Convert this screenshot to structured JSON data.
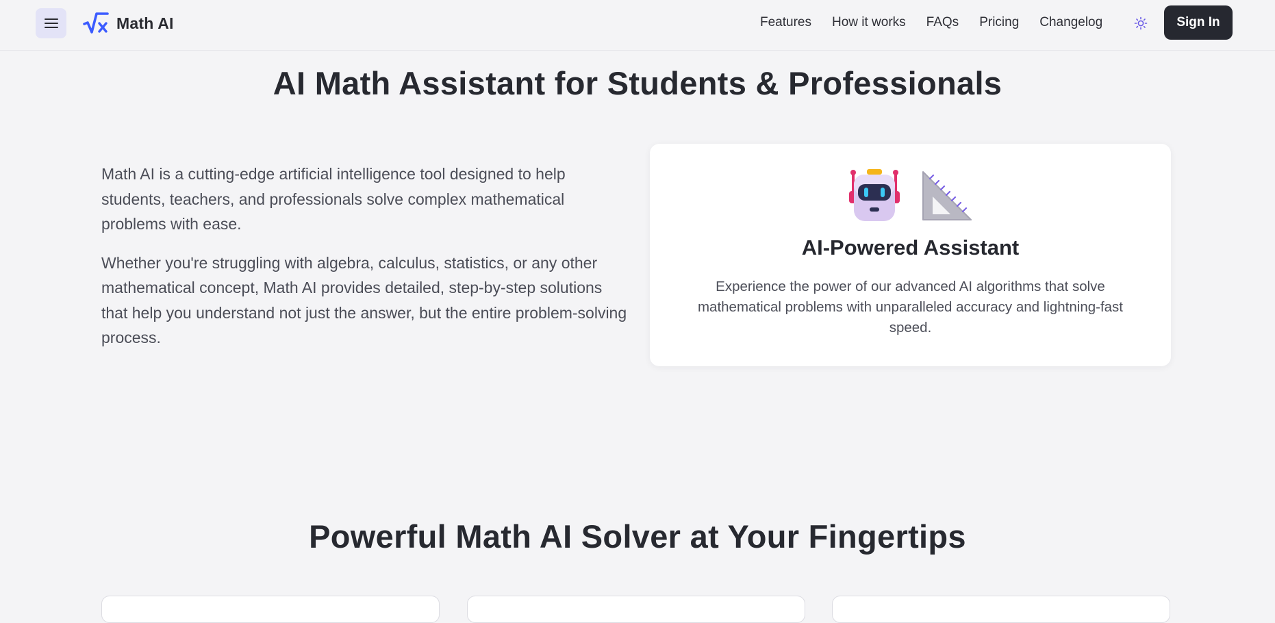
{
  "header": {
    "menu_icon": "hamburger-menu-icon",
    "logo_icon": "sqrt-x-logo-icon",
    "logo_text": "Math AI",
    "nav": [
      {
        "label": "Features"
      },
      {
        "label": "How it works"
      },
      {
        "label": "FAQs"
      },
      {
        "label": "Pricing"
      },
      {
        "label": "Changelog"
      }
    ],
    "theme_icon": "sun-icon",
    "signin_label": "Sign In"
  },
  "hero": {
    "title": "AI Math Assistant for Students & Professionals",
    "paragraphs": [
      "Math AI is a cutting-edge artificial intelligence tool designed to help students, teachers, and professionals solve complex mathematical problems with ease.",
      "Whether you're struggling with algebra, calculus, statistics, or any other mathematical concept, Math AI provides detailed, step-by-step solutions that help you understand not just the answer, but the entire problem-solving process."
    ]
  },
  "feature_card": {
    "icons": [
      "robot-icon",
      "triangular-ruler-icon"
    ],
    "title": "AI-Powered Assistant",
    "description": "Experience the power of our advanced AI algorithms that solve mathematical problems with unparalleled accuracy and lightning-fast speed."
  },
  "solver_section": {
    "title": "Powerful Math AI Solver at Your Fingertips"
  },
  "colors": {
    "background": "#f4f4f6",
    "accent": "#3b5bff",
    "primary_button": "#262830",
    "menu_button_bg": "#e3e3f7"
  }
}
